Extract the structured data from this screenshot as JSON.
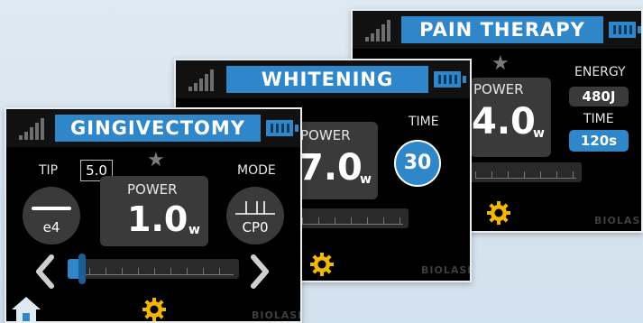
{
  "screens": {
    "pain": {
      "title": "PAIN THERAPY",
      "power_label": "POWER",
      "power_value": "4.0",
      "power_unit": "w",
      "energy_label": "ENERGY",
      "energy_value": "480J",
      "time_label": "TIME",
      "time_value": "120s",
      "brand": "BIOLASE"
    },
    "whitening": {
      "title": "WHITENING",
      "power_label": "POWER",
      "power_value": "7.0",
      "power_unit": "w",
      "time_label": "TIME",
      "time_value": "30",
      "brand": "BIOLASE"
    },
    "gingivectomy": {
      "title": "GINGIVECTOMY",
      "tip_label": "TIP",
      "tip_value": "e4",
      "tip_length": "5.0",
      "power_label": "POWER",
      "power_value": "1.0",
      "power_unit": "w",
      "mode_label": "MODE",
      "mode_value": "CP0",
      "brand": "BIOLASE"
    }
  },
  "colors": {
    "accent": "#2f86c8",
    "panel": "#3a3a3a",
    "background": "#000000",
    "gear": "#f2b705"
  },
  "icons": [
    "signal-icon",
    "battery-icon",
    "star-icon",
    "gear-icon",
    "home-icon",
    "chevron-left-icon",
    "chevron-right-icon"
  ]
}
